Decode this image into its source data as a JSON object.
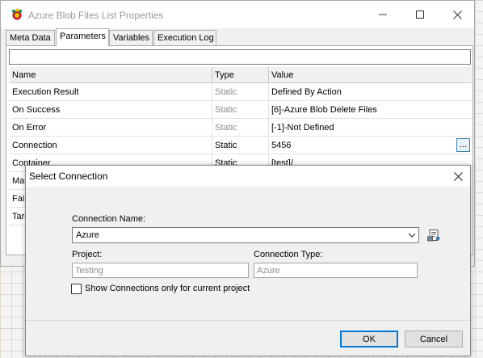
{
  "window": {
    "title": "Azure Blob Files List Properties",
    "tabs": [
      {
        "label": "Meta Data",
        "active": false
      },
      {
        "label": "Parameters",
        "active": true
      },
      {
        "label": "Variables",
        "active": false
      },
      {
        "label": "Execution Log",
        "active": false
      }
    ],
    "filter_value": ""
  },
  "grid": {
    "columns": [
      "Name",
      "Type",
      "Value"
    ],
    "rows": [
      {
        "name": "Execution Result",
        "type": "Static",
        "value": "Defined By Action"
      },
      {
        "name": "On Success",
        "type": "Static",
        "value": "[6]-Azure Blob Delete Files"
      },
      {
        "name": "On Error",
        "type": "Static",
        "value": "[-1]-Not Defined"
      },
      {
        "name": "Connection",
        "type": "Static",
        "value": "5456",
        "ellipsis": "..."
      },
      {
        "name": "Container",
        "type": "Static",
        "value": "[test]/"
      },
      {
        "name": "Mas",
        "type": "",
        "value": ""
      },
      {
        "name": "Fail",
        "type": "",
        "value": ""
      },
      {
        "name": "Targ",
        "type": "",
        "value": ""
      }
    ]
  },
  "dialog": {
    "title": "Select Connection",
    "connection_name_label": "Connection Name:",
    "connection_name_value": "Azure",
    "project_label": "Project:",
    "project_value": "Testing",
    "connection_type_label": "Connection Type:",
    "connection_type_value": "Azure",
    "checkbox_label": "Show Connections only for current project",
    "checkbox_checked": false,
    "ok_label": "OK",
    "cancel_label": "Cancel"
  },
  "icons": {
    "app": "app-icon",
    "minimize": "minimize-icon",
    "maximize": "maximize-icon",
    "close": "close-icon",
    "dropdown": "chevron-down-icon",
    "connection_properties": "properties-icon"
  },
  "colors": {
    "accent": "#0078d7",
    "ellipsis_border": "#3c7fb1",
    "ellipsis_bg": "#e5f1fb",
    "muted_text": "#8c8c8c"
  }
}
